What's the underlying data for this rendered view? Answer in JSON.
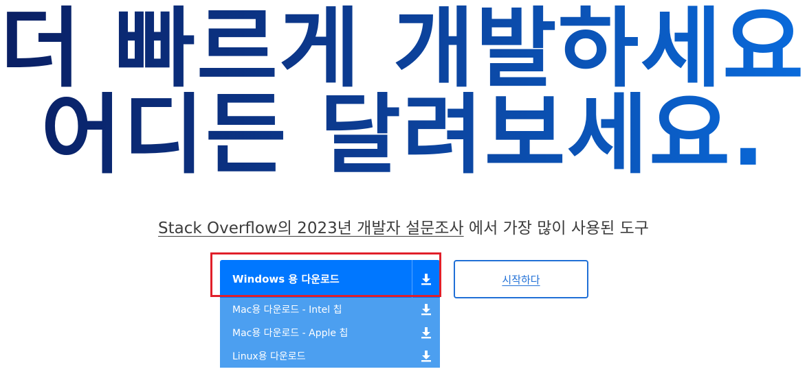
{
  "hero": {
    "line1": "더 빠르게 개발하세요.",
    "line2": "어디든 달려보세요."
  },
  "subtitle": {
    "link_text": "Stack Overflow의 2023년 개발자 설문조사",
    "rest_text": " 에서 가장 많이 사용된 도구"
  },
  "download": {
    "primary_label": "Windows 용 다운로드",
    "icon": "download-icon",
    "options": [
      {
        "label": "Mac용 다운로드 - Intel 칩"
      },
      {
        "label": "Mac용 다운로드 - Apple 칩"
      },
      {
        "label": "Linux용 다운로드"
      }
    ]
  },
  "start_button": {
    "label": "시작하다"
  },
  "colors": {
    "primary_blue": "#0077ff",
    "dropdown_blue": "#4c9ff0",
    "highlight_red": "#e01f2a",
    "outline_blue": "#1f6fd6",
    "hero_dark": "#0a1f63",
    "hero_light": "#0a6bdc"
  }
}
